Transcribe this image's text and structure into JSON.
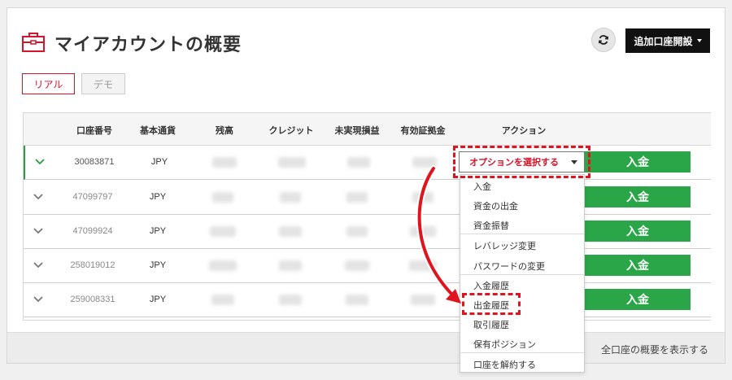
{
  "page": {
    "title": "マイアカウントの概要"
  },
  "header": {
    "refresh_icon": "refresh-icon",
    "open_account_label": "追加口座開設"
  },
  "tabs": {
    "real": "リアル",
    "demo": "デモ"
  },
  "table": {
    "headers": {
      "account_no": "口座番号",
      "base_currency": "基本通貨",
      "balance": "残高",
      "credit": "クレジット",
      "unrealized": "未実現損益",
      "margin": "有効証拠金",
      "action": "アクション"
    },
    "rows": [
      {
        "account": "30083871",
        "currency": "JPY"
      },
      {
        "account": "47099797",
        "currency": "JPY"
      },
      {
        "account": "47099924",
        "currency": "JPY"
      },
      {
        "account": "258019012",
        "currency": "JPY"
      },
      {
        "account": "259008331",
        "currency": "JPY"
      }
    ],
    "deposit_label": "入金"
  },
  "action_select": {
    "label": "オプションを選択する"
  },
  "dropdown": {
    "items": [
      "入金",
      "資金の出金",
      "資金振替",
      "レバレッジ変更",
      "パスワードの変更",
      "入金履歴",
      "出金履歴",
      "取引履歴",
      "保有ポジション",
      "口座を解約する"
    ]
  },
  "footer": {
    "link_label": "全口座の概要を表示する"
  },
  "colors": {
    "accent_red": "#d8142a",
    "deposit_green": "#2aa648",
    "highlight_dashed": "#e0141e",
    "active_row_border": "#2a9d3f"
  }
}
